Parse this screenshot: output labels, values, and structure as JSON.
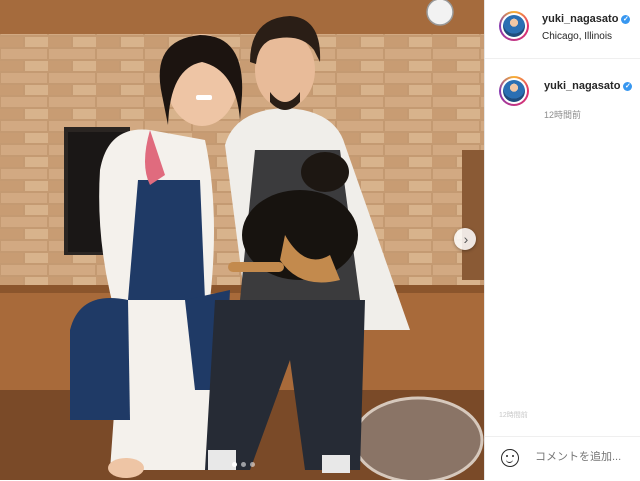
{
  "post": {
    "username": "yuki_nagasato",
    "location": "Chicago, Illinois",
    "caption_username": "yuki_nagasato",
    "time_ago": "12時間前",
    "small_time": "12時間前",
    "comment_placeholder": "コメントを追加...",
    "carousel": {
      "total": 3,
      "active": 1
    },
    "verified_icon": "verified-badge-icon",
    "avatar_icon": "profile-avatar",
    "next_icon": "chevron-right-icon",
    "emoji_icon": "emoji-smiley-icon",
    "colors": {
      "verified": "#3897f0",
      "text": "#262626",
      "muted": "#8e8e8e"
    }
  }
}
